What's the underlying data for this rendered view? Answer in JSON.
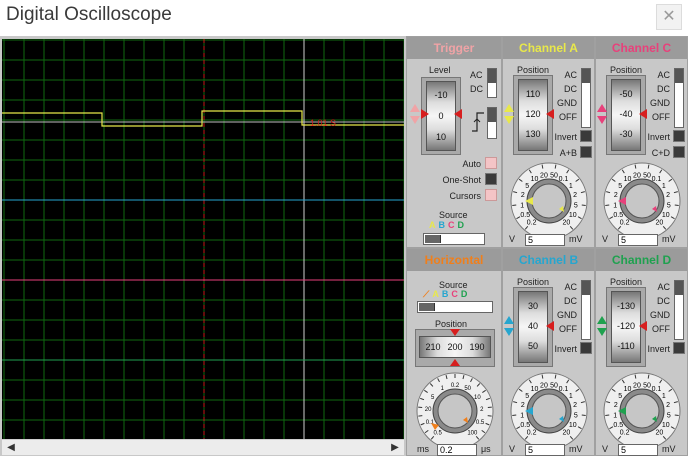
{
  "window": {
    "title": "Digital Oscilloscope",
    "close_glyph": "✕"
  },
  "screen": {
    "marker_label": "1.01 S",
    "scroll_left": "◀",
    "scroll_right": "▶"
  },
  "channel_colors": {
    "A": "#e8e84a",
    "B": "#26a6cf",
    "C": "#e8417b",
    "D": "#1fa14f"
  },
  "trigger": {
    "title": "Trigger",
    "level_label": "Level",
    "drum_values": [
      "-10",
      "0",
      "10"
    ],
    "coupling": [
      "AC",
      "DC"
    ],
    "modes": [
      "Auto",
      "One-Shot",
      "Cursors"
    ],
    "source_label": "Source",
    "source_letters": [
      "A",
      "B",
      "C",
      "D"
    ]
  },
  "horizontal": {
    "title": "Horizontal",
    "source_label": "Source",
    "source_letters": [
      "A",
      "B",
      "C",
      "D"
    ],
    "position_label": "Position",
    "drum_values": [
      "210",
      "200",
      "190"
    ],
    "dial_ticks": [
      "0.5",
      "0.2",
      "0.1",
      "50",
      "20",
      "10",
      "5",
      "2",
      "1",
      "0.5",
      "0.2",
      "0.1",
      "50",
      "20",
      "10",
      "5",
      "2",
      "1",
      "0.5",
      "200",
      "100"
    ],
    "unit_left": "ms",
    "unit_right": "μs",
    "value": "0.2"
  },
  "channels": [
    {
      "id": "A",
      "title": "Channel A",
      "position_label": "Position",
      "drum_values": [
        "110",
        "120",
        "130"
      ],
      "coupling": [
        "AC",
        "DC",
        "GND",
        "OFF"
      ],
      "invert_label": "Invert",
      "extra_label": "A+B",
      "dial_ticks": [
        "0.2",
        "0.5",
        "1",
        "2",
        "5",
        "10",
        "20",
        "50",
        "0.1",
        "1",
        "2",
        "5",
        "10",
        "20"
      ],
      "unit_left": "V",
      "unit_right": "mV",
      "value": "5"
    },
    {
      "id": "C",
      "title": "Channel C",
      "position_label": "Position",
      "drum_values": [
        "-50",
        "-40",
        "-30"
      ],
      "coupling": [
        "AC",
        "DC",
        "GND",
        "OFF"
      ],
      "invert_label": "Invert",
      "extra_label": "C+D",
      "dial_ticks": [
        "0.2",
        "0.5",
        "1",
        "2",
        "5",
        "10",
        "20",
        "50",
        "0.1",
        "1",
        "2",
        "5",
        "10",
        "20"
      ],
      "unit_left": "V",
      "unit_right": "mV",
      "value": "5"
    },
    {
      "id": "B",
      "title": "Channel B",
      "position_label": "Position",
      "drum_values": [
        "30",
        "40",
        "50"
      ],
      "coupling": [
        "AC",
        "DC",
        "GND",
        "OFF"
      ],
      "invert_label": "Invert",
      "extra_label": "",
      "dial_ticks": [
        "0.2",
        "0.5",
        "1",
        "2",
        "5",
        "10",
        "20",
        "50",
        "0.1",
        "1",
        "2",
        "5",
        "10",
        "20"
      ],
      "unit_left": "V",
      "unit_right": "mV",
      "value": "5"
    },
    {
      "id": "D",
      "title": "Channel D",
      "position_label": "Position",
      "drum_values": [
        "-130",
        "-120",
        "-110"
      ],
      "coupling": [
        "AC",
        "DC",
        "GND",
        "OFF"
      ],
      "invert_label": "Invert",
      "extra_label": "",
      "dial_ticks": [
        "0.2",
        "0.5",
        "1",
        "2",
        "5",
        "10",
        "20",
        "50",
        "0.1",
        "1",
        "2",
        "5",
        "10",
        "20"
      ],
      "unit_left": "V",
      "unit_right": "mV",
      "value": "5"
    }
  ]
}
